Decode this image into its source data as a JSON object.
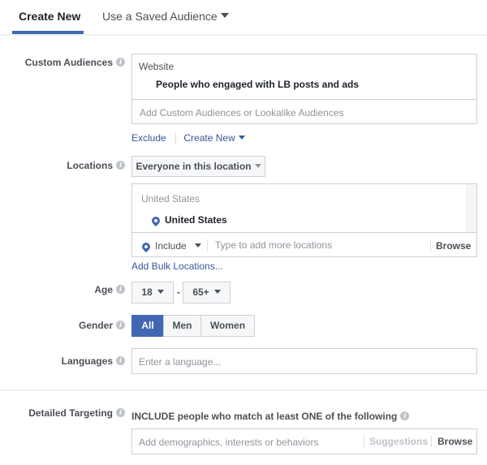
{
  "tabs": {
    "create_new": "Create New",
    "saved_audience": "Use a Saved Audience"
  },
  "custom_audiences": {
    "label": "Custom Audiences",
    "group_title": "Website",
    "selected": "People who engaged with LB posts and ads",
    "placeholder": "Add Custom Audiences or Lookalike Audiences",
    "exclude_link": "Exclude",
    "create_new_link": "Create New"
  },
  "locations": {
    "label": "Locations",
    "type_dropdown": "Everyone in this location",
    "group_title": "United States",
    "selected": "United States",
    "include_dropdown": "Include",
    "placeholder": "Type to add more locations",
    "browse": "Browse",
    "bulk_link": "Add Bulk Locations..."
  },
  "age": {
    "label": "Age",
    "min": "18",
    "separator": "-",
    "max": "65+"
  },
  "gender": {
    "label": "Gender",
    "options": [
      "All",
      "Men",
      "Women"
    ],
    "selected": "All"
  },
  "languages": {
    "label": "Languages",
    "placeholder": "Enter a language..."
  },
  "detailed_targeting": {
    "label": "Detailed Targeting",
    "include_text": "INCLUDE people who match at least ONE of the following",
    "placeholder": "Add demographics, interests or behaviors",
    "suggestions": "Suggestions",
    "browse": "Browse"
  },
  "colors": {
    "accent": "#4267b2",
    "link": "#365899",
    "label": "#4b4f56",
    "border": "#ccd0d5"
  }
}
